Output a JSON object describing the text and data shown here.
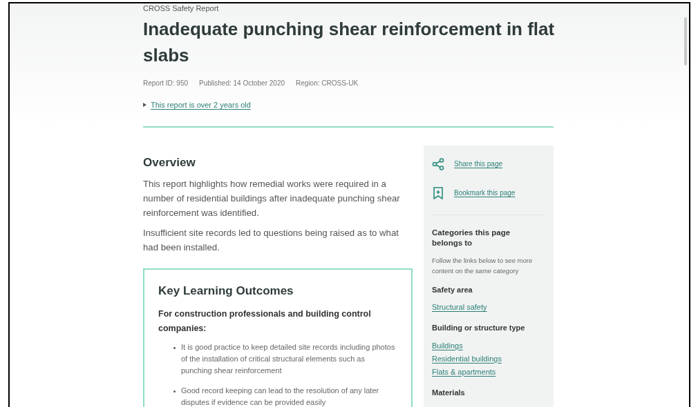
{
  "header": {
    "eyebrow": "CROSS Safety Report",
    "title": "Inadequate punching shear reinforcement in flat slabs",
    "meta": [
      "Report ID: 950",
      "Published: 14 October 2020",
      "Region: CROSS-UK"
    ],
    "age_notice": {
      "label": "This report is over 2 years old",
      "expanded": false
    }
  },
  "overview": {
    "heading": "Overview",
    "paragraphs": [
      "This report highlights how remedial works were required in a number of residential buildings after inadequate punching shear reinforcement was identified.",
      "Insufficient site records led to questions being raised as to what had been installed."
    ]
  },
  "key_learning": {
    "heading": "Key Learning Outcomes",
    "audience": "For construction professionals and building control companies:",
    "points": [
      "It is good practice to keep detailed site records including photos of the installation of critical structural elements such as punching shear reinforcement",
      "Good record keeping can lead to the resolution of any later disputes if evidence can be provided easily"
    ]
  },
  "sidebar": {
    "actions": [
      {
        "kind": "share",
        "label": "Share this page"
      },
      {
        "kind": "bookmark",
        "label": "Bookmark this page"
      }
    ],
    "categories_heading": "Categories this page belongs to",
    "categories_hint": "Follow the links below to see more content on the same category",
    "groups": [
      {
        "heading": "Safety area",
        "links": [
          "Structural safety"
        ]
      },
      {
        "heading": "Building or structure type",
        "links": [
          "Buildings",
          "Residential buildings",
          "Flats & apartments"
        ]
      },
      {
        "heading": "Materials"
      }
    ]
  }
}
